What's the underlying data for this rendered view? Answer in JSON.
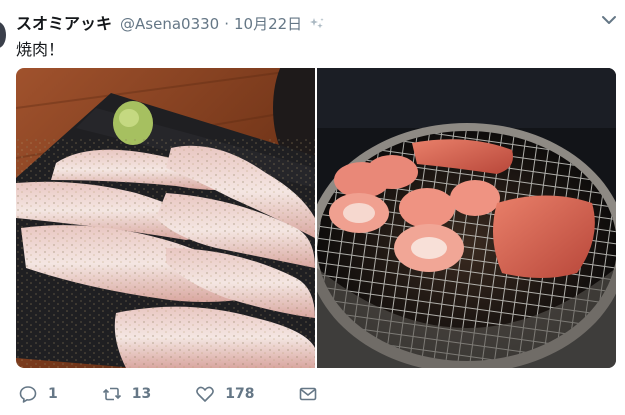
{
  "tweet": {
    "display_name": "スオミアッキ",
    "handle": "@Asena0330",
    "separator": "·",
    "timestamp": "10月22日",
    "source_icon": "sparkle-icon",
    "menu_icon": "chevron-down-icon",
    "text": "焼肉！"
  },
  "media": {
    "photos": [
      {
        "name": "sliced-pork-plate-photo"
      },
      {
        "name": "yakiniku-grill-photo"
      }
    ]
  },
  "actions": {
    "reply": {
      "icon": "reply-icon",
      "count": "1"
    },
    "retweet": {
      "icon": "retweet-icon",
      "count": "13"
    },
    "like": {
      "icon": "heart-icon",
      "count": "178"
    },
    "message": {
      "icon": "envelope-icon"
    }
  },
  "colors": {
    "text": "#14171a",
    "muted": "#657786",
    "background": "#ffffff"
  }
}
